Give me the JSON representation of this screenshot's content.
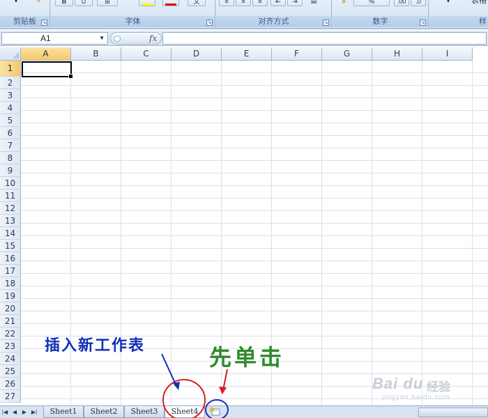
{
  "ribbon": {
    "groups": [
      {
        "label": "剪贴板"
      },
      {
        "label": "字体"
      },
      {
        "label": "对齐方式"
      },
      {
        "label": "数字"
      },
      {
        "label": "样"
      }
    ],
    "number_format": "%",
    "style_button": "表格"
  },
  "formula_bar": {
    "name_box": "A1",
    "fx_label": "fx",
    "formula": ""
  },
  "grid": {
    "columns": [
      "A",
      "B",
      "C",
      "D",
      "E",
      "F",
      "G",
      "H",
      "I"
    ],
    "rows": [
      "1",
      "2",
      "3",
      "4",
      "5",
      "6",
      "7",
      "8",
      "9",
      "10",
      "11",
      "12",
      "13",
      "14",
      "15",
      "16",
      "17",
      "18",
      "19",
      "20",
      "21",
      "22",
      "23",
      "24",
      "25",
      "26",
      "27"
    ],
    "active_cell": "A1"
  },
  "sheets": {
    "tabs": [
      "Sheet1",
      "Sheet2",
      "Sheet3",
      "Sheet4"
    ],
    "active": "Sheet4",
    "nav_buttons": [
      "first-sheet-icon",
      "prev-sheet-icon",
      "next-sheet-icon",
      "last-sheet-icon"
    ]
  },
  "annotations": {
    "insert_label": "插入新工作表",
    "click_first": "先单击",
    "highlight_red": "#d81e1e",
    "highlight_blue": "#1f2fb8"
  },
  "watermark": {
    "brand": "Bai du",
    "brand_cn": "经验",
    "url": "jingyan.baidu.com"
  }
}
